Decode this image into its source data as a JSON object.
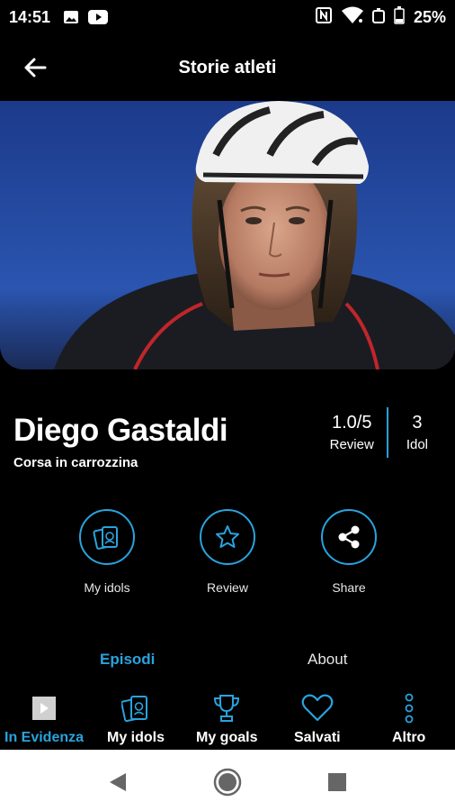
{
  "status_bar": {
    "time": "14:51",
    "battery": "25%",
    "icons": [
      "image-icon",
      "youtube-icon",
      "nfc-icon",
      "wifi-icon",
      "alarm-icon",
      "battery-icon"
    ]
  },
  "app_bar": {
    "title": "Storie atleti"
  },
  "athlete": {
    "name": "Diego Gastaldi",
    "sport": "Corsa in carrozzina"
  },
  "stats": {
    "review_value": "1.0/5",
    "review_label": "Review",
    "idol_value": "3",
    "idol_label": "Idol"
  },
  "actions": [
    {
      "label": "My idols",
      "icon": "idol-cards-icon"
    },
    {
      "label": "Review",
      "icon": "star-icon"
    },
    {
      "label": "Share",
      "icon": "share-icon"
    }
  ],
  "tabs": {
    "episodi": "Episodi",
    "about": "About",
    "active": "Episodi"
  },
  "bottom_nav": [
    {
      "label": "In Evidenza",
      "icon": "featured-icon",
      "active": true
    },
    {
      "label": "My idols",
      "icon": "idol-cards-icon",
      "active": false
    },
    {
      "label": "My goals",
      "icon": "trophy-icon",
      "active": false
    },
    {
      "label": "Salvati",
      "icon": "heart-icon",
      "active": false
    },
    {
      "label": "Altro",
      "icon": "more-icon",
      "active": false
    }
  ],
  "colors": {
    "accent": "#29a3dd",
    "background": "#000000",
    "text": "#ffffff"
  }
}
